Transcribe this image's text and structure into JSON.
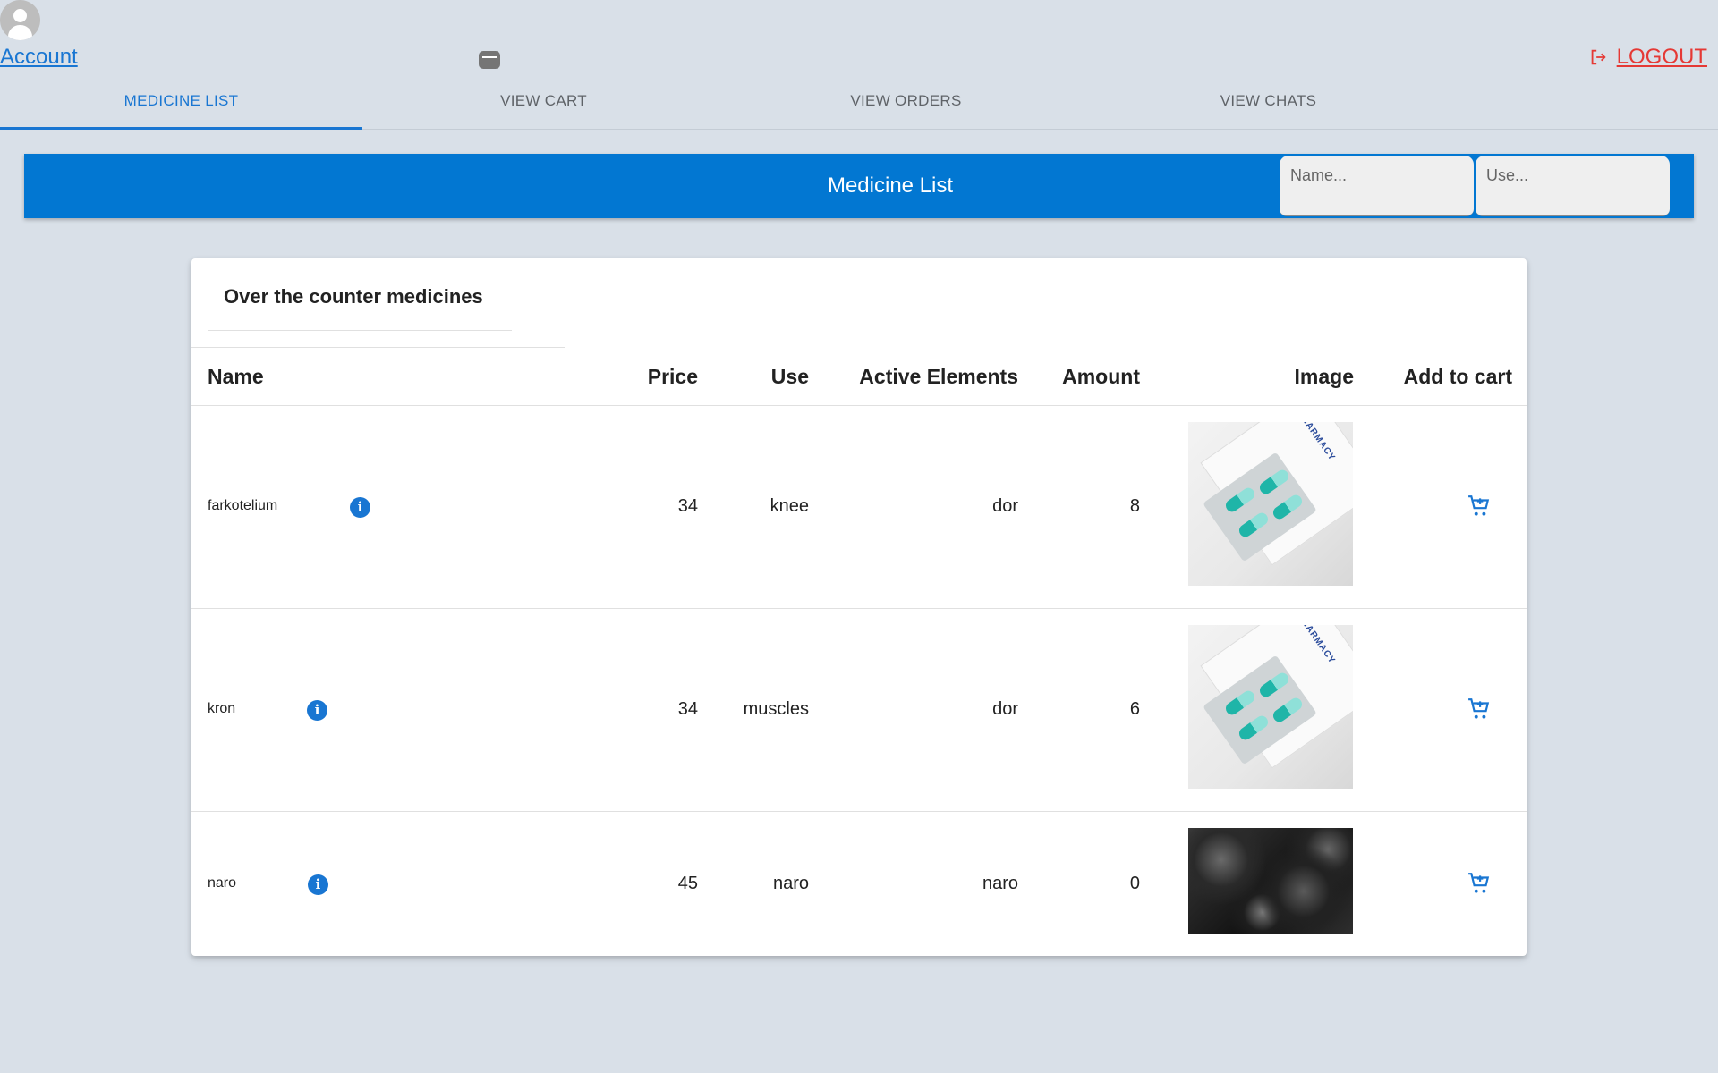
{
  "header": {
    "account_label": "Account",
    "logout_label": "LOGOUT"
  },
  "tabs": [
    {
      "label": "MEDICINE LIST",
      "active": true
    },
    {
      "label": "VIEW CART",
      "active": false
    },
    {
      "label": "VIEW ORDERS",
      "active": false
    },
    {
      "label": "VIEW CHATS",
      "active": false
    }
  ],
  "banner": {
    "title": "Medicine List",
    "name_placeholder": "Name...",
    "use_placeholder": "Use..."
  },
  "table": {
    "title": "Over the counter medicines",
    "columns": [
      "Name",
      "Price",
      "Use",
      "Active Elements",
      "Amount",
      "Image",
      "Add to cart"
    ],
    "rows": [
      {
        "name": "farkotelium",
        "price": "34",
        "use": "knee",
        "active_elements": "dor",
        "amount": "8",
        "image": "pill-pack-image"
      },
      {
        "name": "kron",
        "price": "34",
        "use": "muscles",
        "active_elements": "dor",
        "amount": "6",
        "image": "pill-pack-image"
      },
      {
        "name": "naro",
        "price": "45",
        "use": "naro",
        "active_elements": "naro",
        "amount": "0",
        "image": "dark-rock-image"
      }
    ]
  },
  "colors": {
    "accent": "#1976d2",
    "banner": "#0277d2",
    "logout": "#e53935",
    "background": "#d9e0e8"
  }
}
